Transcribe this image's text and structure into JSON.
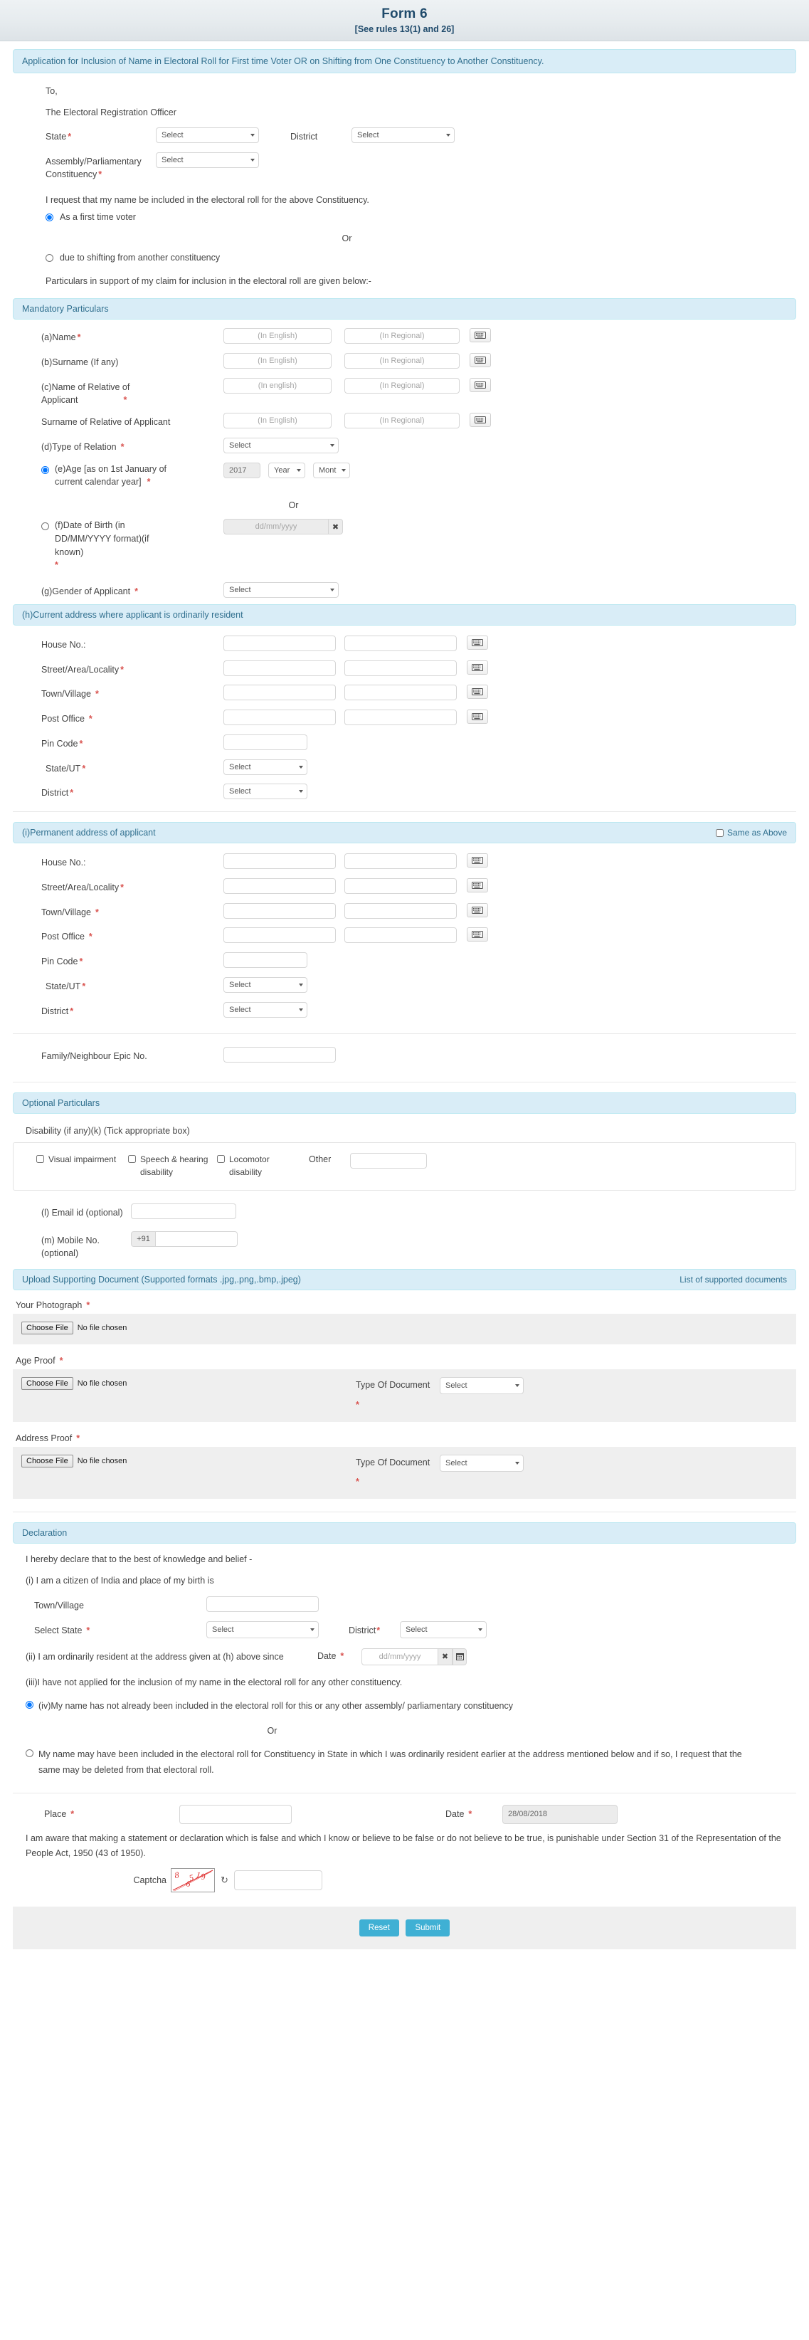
{
  "header": {
    "title": "Form 6",
    "subtitle": "[See rules 13(1) and 26]"
  },
  "notice": "Application for Inclusion of Name in Electoral Roll for First time Voter OR on Shifting from One Constituency to Another Constituency.",
  "addressee": {
    "to": "To,",
    "officer": "The Electoral Registration Officer"
  },
  "placeholders": {
    "select": "Select",
    "in_english": "(In English)",
    "in_english_lower": "(In english)",
    "in_regional": "(In Regional)",
    "ddmmyyyy": "dd/mm/yyyy",
    "year": "Year",
    "month": "Month",
    "empty": ""
  },
  "top": {
    "state_label": "State",
    "state_value": "Select",
    "district_label": "District",
    "district_value": "Select",
    "constituency_label": "Assembly/Parliamentary Constituency",
    "constituency_value": "Select",
    "request_text": "I request that my name be included in the electoral roll for the above Constituency.",
    "option_first_time": "As a first time voter",
    "or": "Or",
    "option_shifting": "due to shifting from another constituency",
    "particulars_text": "Particulars in support of my claim for inclusion in the electoral roll are given below:-"
  },
  "mandatory": {
    "heading": "Mandatory Particulars",
    "name_label": "(a)Name",
    "surname_label": "(b)Surname (If any)",
    "relative_name_label_1": "(c)Name of Relative of",
    "relative_name_label_2": "Applicant",
    "relative_surname_label": "Surname of Relative of Applicant",
    "type_of_relation_label": "(d)Type of Relation",
    "type_of_relation_value": "Select",
    "age_label_1": "(e)Age [as on 1st January of",
    "age_label_2": "current calendar year]",
    "age_year_value": "2017",
    "age_year_unit": "Year",
    "age_month_unit": "Month",
    "or": "Or",
    "dob_label_1": "(f)Date of Birth (in",
    "dob_label_2": "DD/MM/YYYY format)(if",
    "dob_label_3": "known)",
    "gender_label": "(g)Gender of Applicant",
    "gender_value": "Select"
  },
  "current_address": {
    "heading": "(h)Current address where applicant is ordinarily resident",
    "house_no": "House No.:",
    "street": "Street/Area/Locality",
    "town": "Town/Village",
    "post_office": "Post Office",
    "pin_code": "Pin Code",
    "state_ut": "State/UT",
    "state_ut_value": "Select",
    "district": "District",
    "district_value": "Select"
  },
  "permanent_address": {
    "heading": "(i)Permanent address of applicant",
    "same_as_above": "Same as Above",
    "house_no": "House No.:",
    "street": "Street/Area/Locality",
    "town": "Town/Village",
    "post_office": "Post Office",
    "pin_code": "Pin Code",
    "state_ut": "State/UT",
    "state_ut_value": "Select",
    "district": "District",
    "district_value": "Select"
  },
  "epic": {
    "label": "Family/Neighbour Epic No."
  },
  "optional": {
    "heading": "Optional Particulars",
    "disability_label": "Disability (if any)(k) (Tick appropriate box)",
    "disability_options": [
      "Visual impairment",
      "Speech & hearing disability",
      "Locomotor disability"
    ],
    "other_label": "Other",
    "email_label": "(l) Email id (optional)",
    "mobile_label": "(m) Mobile No. (optional)",
    "mobile_prefix": "+91"
  },
  "upload": {
    "heading": "Upload Supporting Document (Supported formats .jpg,.png,.bmp,.jpeg)",
    "list_link": "List of supported documents",
    "photograph_label": "Your Photograph",
    "age_proof_label": "Age Proof",
    "address_proof_label": "Address Proof",
    "choose_file": "Choose File",
    "no_file_chosen": "No file chosen",
    "type_of_document": "Type Of Document",
    "type_value": "Select"
  },
  "declaration": {
    "heading": "Declaration",
    "intro": "I hereby declare that to the best of knowledge and belief -",
    "item_i": "(i) I am a citizen of India and place of my birth is",
    "town_label": "Town/Village",
    "select_state_label": "Select State",
    "select_state_value": "Select",
    "district_label": "District",
    "district_value": "Select",
    "item_ii": "(ii) I am ordinarily resident at the address given at (h) above since",
    "date_label": "Date",
    "item_iii": "(iii)I have not applied for the inclusion of my name in the electoral roll for any other constituency.",
    "item_iv": "(iv)My name has not already been included in the electoral roll for this or any other assembly/ parliamentary constituency",
    "or": "Or",
    "item_v": "My name may have been included in the electoral roll for Constituency in State in which I was ordinarily resident earlier at the address mentioned below and if so, I request that the same may be deleted from that electoral roll."
  },
  "footer": {
    "place_label": "Place",
    "date_label": "Date",
    "date_value": "28/08/2018",
    "awareness_text": "I am aware that making a statement or declaration which is false and which I know or believe to be false or do not believe to be true, is punishable under Section 31 of the Representation of the People Act, 1950 (43 of 1950).",
    "captcha_label": "Captcha",
    "captcha_value": "86519",
    "reset_label": "Reset",
    "submit_label": "Submit"
  },
  "colors": {
    "accent": "#3fb0d4",
    "panel": "#d9edf7",
    "panel_border": "#bce8f1",
    "panel_text": "#31708f",
    "required": "#d9534f"
  }
}
